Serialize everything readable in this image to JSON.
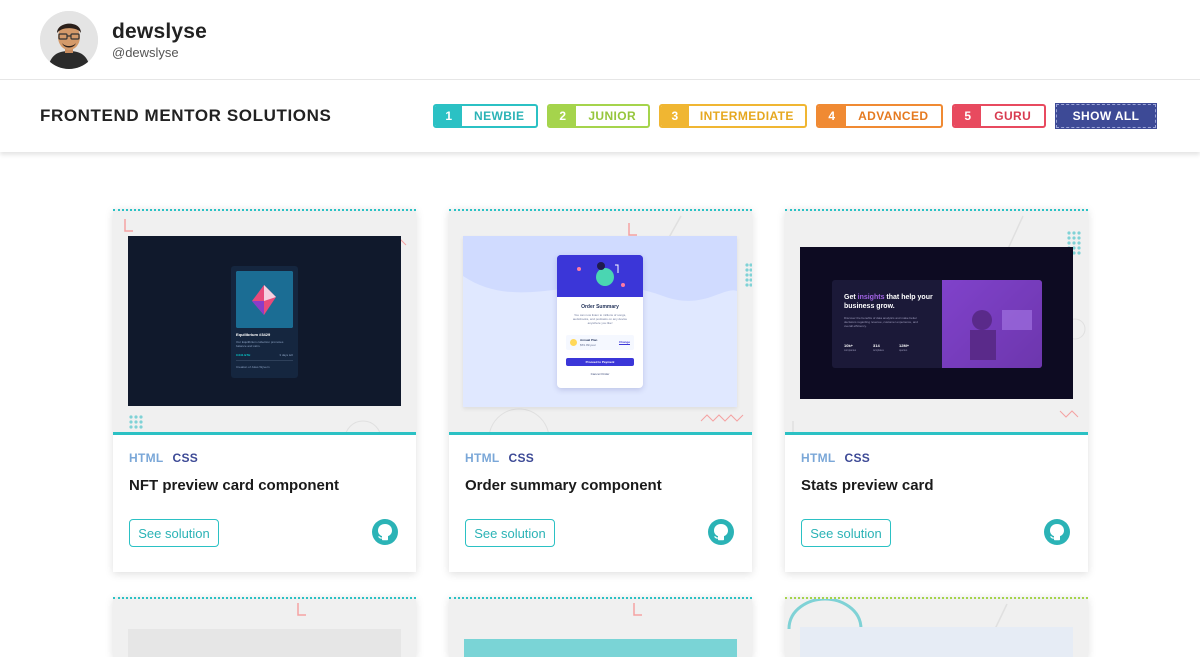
{
  "profile": {
    "name": "dewslyse",
    "handle": "@dewslyse"
  },
  "filterbar": {
    "title": "FRONTEND MENTOR SOLUTIONS",
    "levels": [
      {
        "num": "1",
        "label": "NEWBIE",
        "color": "#2bc1c4"
      },
      {
        "num": "2",
        "label": "JUNIOR",
        "color": "#a5d44c"
      },
      {
        "num": "3",
        "label": "INTERMEDIATE",
        "color": "#f0b632"
      },
      {
        "num": "4",
        "label": "ADVANCED",
        "color": "#f08a33"
      },
      {
        "num": "5",
        "label": "GURU",
        "color": "#e84a5f"
      }
    ],
    "show_all": "SHOW ALL"
  },
  "cards": [
    {
      "tags": [
        "HTML",
        "CSS"
      ],
      "title": "NFT preview card component",
      "button": "See solution",
      "preview": {
        "nft_title": "Equilibrium #3429",
        "nft_desc": "Our Equilibrium collection promotes balance and calm.",
        "nft_price": "0.041 ETH",
        "nft_time": "3 days left",
        "nft_creator": "Creation of Jules Wyvern"
      }
    },
    {
      "tags": [
        "HTML",
        "CSS"
      ],
      "title": "Order summary component",
      "button": "See solution",
      "preview": {
        "heading": "Order Summary",
        "desc": "You can now listen to millions of songs, audiobooks, and podcasts on any device anywhere you like!",
        "plan": "Annual Plan",
        "price": "$59.99/year",
        "change": "Change",
        "proceed": "Proceed to Payment",
        "cancel": "Cancel Order"
      }
    },
    {
      "tags": [
        "HTML",
        "CSS"
      ],
      "title": "Stats preview card",
      "button": "See solution",
      "preview": {
        "heading_a": "Get ",
        "heading_hl": "insights",
        "heading_b": " that help your business grow.",
        "desc": "Discover the benefits of data analytics and make better decisions regarding revenue, customer experience, and overall efficiency.",
        "stats": [
          {
            "value": "10k+",
            "label": "companies"
          },
          {
            "value": "314",
            "label": "templates"
          },
          {
            "value": "12M+",
            "label": "queries"
          }
        ]
      }
    }
  ]
}
